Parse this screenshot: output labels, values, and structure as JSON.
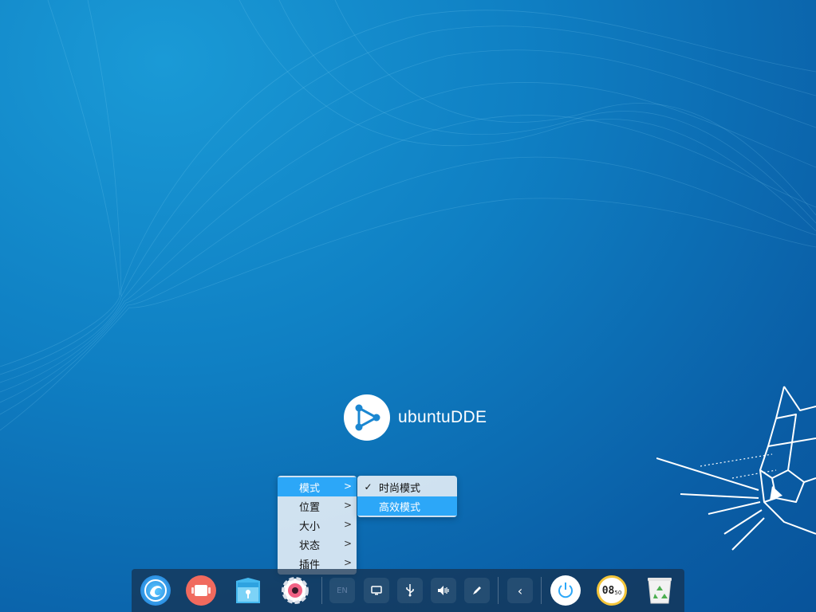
{
  "desktop": {
    "logo_text": "ubuntuDDE"
  },
  "dock_menu": {
    "items": [
      {
        "label": "模式",
        "active": true
      },
      {
        "label": "位置",
        "active": false
      },
      {
        "label": "大小",
        "active": false
      },
      {
        "label": "状态",
        "active": false
      },
      {
        "label": "插件",
        "active": false
      }
    ],
    "chevron": ">"
  },
  "mode_submenu": {
    "items": [
      {
        "label": "时尚模式",
        "checked": true,
        "check_mark": "✓"
      },
      {
        "label": "高效模式",
        "checked": false,
        "check_mark": ""
      }
    ]
  },
  "dock": {
    "tray": {
      "keyboard_layout": "EN",
      "expand_toggle": "‹"
    },
    "clock": {
      "hours": "08",
      "minutes": "50"
    }
  }
}
